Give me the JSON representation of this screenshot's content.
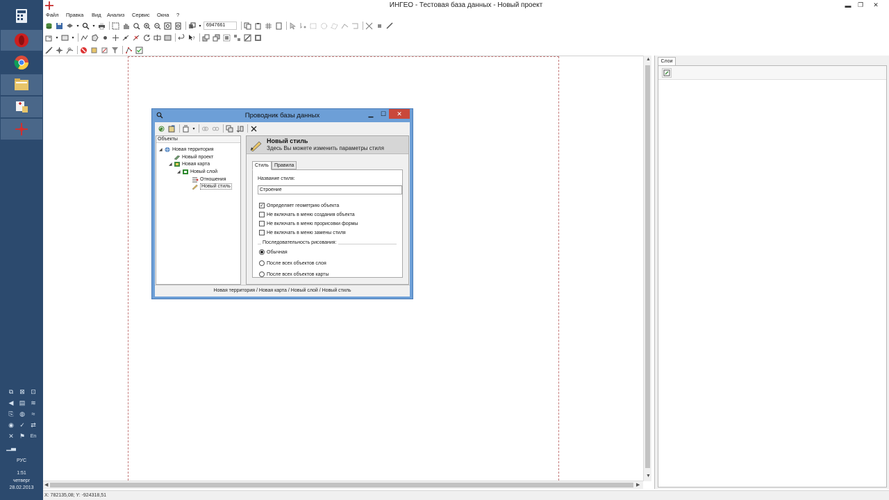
{
  "window": {
    "title": "ИНГЕО - Тестовая база данных - Новый проект",
    "controls": {
      "minimize": "▬",
      "restore": "❐",
      "close": "✕"
    }
  },
  "menu": [
    "Файл",
    "Правка",
    "Вид",
    "Анализ",
    "Сервис",
    "Окна",
    "?"
  ],
  "toolbar": {
    "scale_value": "6947661"
  },
  "status": {
    "coords": "X: 782135,08; Y: -924318,51"
  },
  "layers_panel": {
    "tab_label": "Слои"
  },
  "taskbar": {
    "lang": "РУС",
    "time": "1:51",
    "day": "четверг",
    "date": "28.02.2013",
    "tray_lang": "En"
  },
  "dialog": {
    "title": "Проводник базы данных",
    "tree_header": "Объекты",
    "tree": [
      {
        "label": "Новая территория",
        "icon": "territory-icon"
      },
      {
        "label": "Новый проект",
        "icon": "project-icon"
      },
      {
        "label": "Новая карта",
        "icon": "map-icon"
      },
      {
        "label": "Новый слой",
        "icon": "layer-icon"
      },
      {
        "label": "Отношения",
        "icon": "relations-icon"
      },
      {
        "label": "Новый стиль",
        "icon": "style-icon"
      }
    ],
    "props": {
      "title": "Новый стиль",
      "subtitle": "Здесь Вы можете изменить параметры стиля",
      "tabs": [
        "Стиль",
        "Правила"
      ],
      "name_label": "Название стиля:",
      "name_value": "Строение",
      "checkboxes": [
        {
          "label": "Определяет геометрию объекта",
          "checked": true
        },
        {
          "label": "Не включать в меню создания объекта",
          "checked": false
        },
        {
          "label": "Не включать в меню прорисовки формы",
          "checked": false
        },
        {
          "label": "Не включать в меню замены стиля",
          "checked": false
        }
      ],
      "draw_group_label": "Последовательность рисования:",
      "radios": [
        {
          "label": "Обычная",
          "selected": true
        },
        {
          "label": "После всех объектов слоя",
          "selected": false
        },
        {
          "label": "После всех объектов карты",
          "selected": false
        }
      ]
    },
    "path": "Новая территория / Новая карта / Новый слой / Новый стиль"
  }
}
